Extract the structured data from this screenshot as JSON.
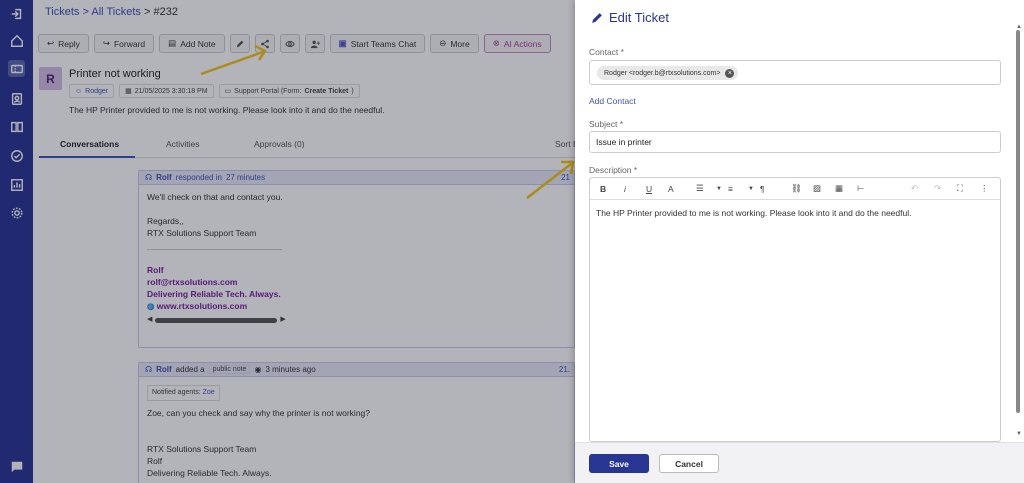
{
  "breadcrumb": {
    "tickets": "Tickets",
    "sep1": ">",
    "all": "All Tickets",
    "sep2": ">",
    "current": "#232"
  },
  "toolbar": {
    "reply": "Reply",
    "forward": "Forward",
    "add_note": "Add Note",
    "teams": "Start Teams Chat",
    "more": "More",
    "ai": "AI Actions"
  },
  "ticket": {
    "avatar": "R",
    "title": "Printer not working",
    "requester": "Rodger",
    "date": "21/05/2025 3:30:18 PM",
    "source_label": "Support Portal (Form:",
    "source_form": "Create Ticket",
    "source_close": ")",
    "description": "The HP Printer provided to me is not working. Please look into it and do the needful."
  },
  "tabs": {
    "conversations": "Conversations",
    "activities": "Activities",
    "approvals": "Approvals (0)",
    "sort": "Sort By"
  },
  "conversation1": {
    "name": "Rolf",
    "action": "responded in",
    "time": "27 minutes",
    "right": "21",
    "line1": "We'll check on that and contact you.",
    "line2": "Regards,,",
    "line3": "RTX Solutions Support Team",
    "sig_name": "Rolf",
    "sig_email": "rolf@rtxsolutions.com",
    "sig_tagline": "Delivering Reliable Tech. Always.",
    "sig_web": "www.rtxsolutions.com"
  },
  "conversation2": {
    "name": "Rolf",
    "action": "added a",
    "note_type": "public note",
    "time": "3 minutes ago",
    "right": "21.",
    "notified_label": "Notified agents:",
    "notified_agent": "Zoe",
    "line1": "Zoe, can you check and say why the printer is not working?",
    "line2": "RTX Solutions Support Team",
    "line3": "Rolf",
    "line4": "Delivering Reliable Tech. Always."
  },
  "panel": {
    "title": "Edit Ticket",
    "contact_label": "Contact *",
    "contact_chip": "Rodger <rodger.b@rtxsolutions.com>",
    "add_contact": "Add Contact",
    "subject_label": "Subject *",
    "subject_value": "Issue in printer",
    "description_label": "Description *",
    "description_value": "The HP Printer provided to me is not working. Please look into it and do the needful.",
    "save": "Save",
    "cancel": "Cancel"
  },
  "editor_toolbar": {
    "bold": "B",
    "italic": "i",
    "underline": "U",
    "font_size": "A",
    "paragraph": "¶"
  },
  "colors": {
    "sidebar": "#283593",
    "accent": "#3f51b5",
    "ai_accent": "#b03aa6",
    "signature": "#7b1fa2",
    "annotation_arrow": "#f5c518"
  }
}
